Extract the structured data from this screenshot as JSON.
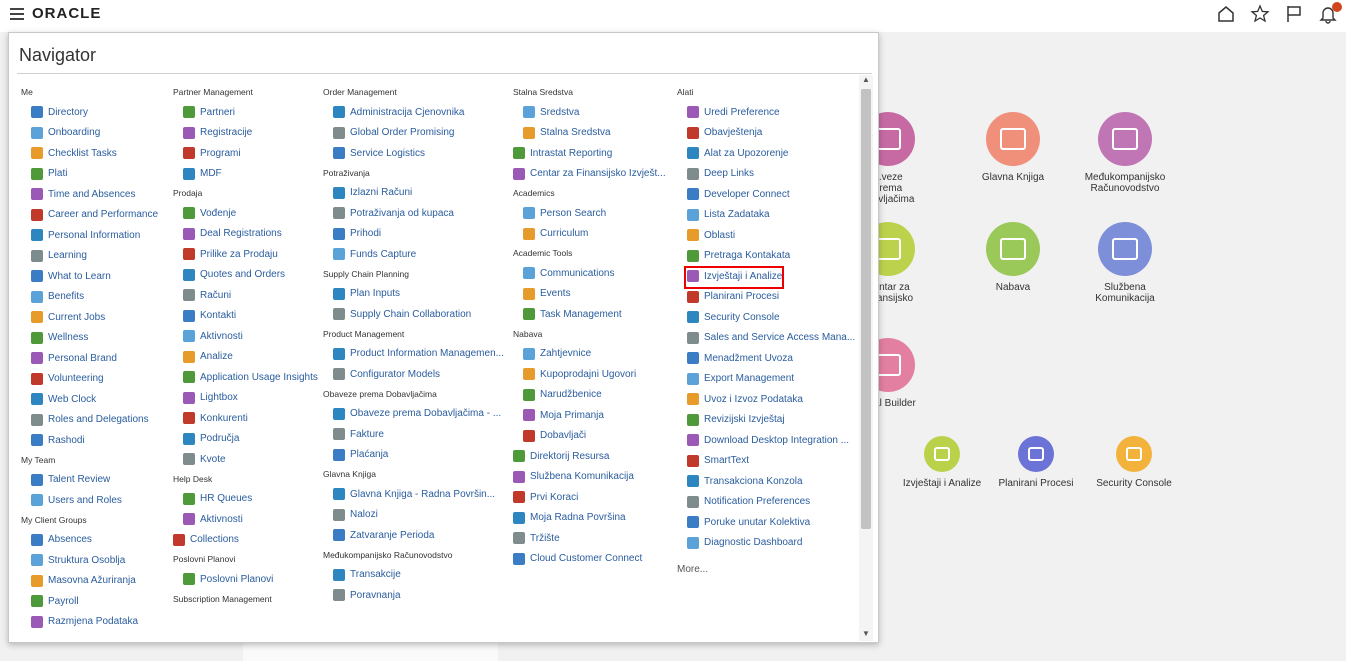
{
  "header": {
    "logo": "ORACLE",
    "icons": [
      "menu-icon",
      "home-icon",
      "star-icon",
      "flag-icon",
      "bell-icon"
    ]
  },
  "navigator": {
    "title": "Navigator",
    "columns": [
      {
        "groups": [
          {
            "title": "Me",
            "items": [
              "Directory",
              "Onboarding",
              "Checklist Tasks",
              "Plati",
              "Time and Absences",
              "Career and Performance",
              "Personal Information",
              "Learning",
              "What to Learn",
              "Benefits",
              "Current Jobs",
              "Wellness",
              "Personal Brand",
              "Volunteering",
              "Web Clock",
              "Roles and Delegations",
              "Rashodi"
            ]
          },
          {
            "title": "My Team",
            "items": [
              "Talent Review",
              "Users and Roles"
            ]
          },
          {
            "title": "My Client Groups",
            "items": [
              "Absences",
              "Struktura Osoblja",
              "Masovna Ažuriranja",
              "Payroll",
              "Razmjena Podataka"
            ]
          }
        ]
      },
      {
        "groups": [
          {
            "title": "Partner Management",
            "items": [
              "Partneri",
              "Registracije",
              "Programi",
              "MDF"
            ]
          },
          {
            "title": "Prodaja",
            "items": [
              "Vođenje",
              "Deal Registrations",
              "Prilike za Prodaju",
              "Quotes and Orders",
              "Računi",
              "Kontakti",
              "Aktivnosti",
              "Analize",
              "Application Usage Insights",
              "Lightbox",
              "Konkurenti",
              "Područja",
              "Kvote"
            ]
          },
          {
            "title": "Help Desk",
            "items": [
              "HR Queues",
              "Aktivnosti"
            ],
            "plain_items": [
              "Collections"
            ]
          },
          {
            "title": "Poslovni Planovi",
            "items": [
              "Poslovni Planovi"
            ]
          },
          {
            "title": "Subscription Management",
            "items": []
          }
        ]
      },
      {
        "groups": [
          {
            "title": "Order Management",
            "items": [
              "Administracija Cjenovnika",
              "Global Order Promising",
              "Service Logistics"
            ]
          },
          {
            "title": "Potraživanja",
            "items": [
              "Izlazni Računi",
              "Potraživanja od kupaca",
              "Prihodi",
              "Funds Capture"
            ]
          },
          {
            "title": "Supply Chain Planning",
            "items": [
              "Plan Inputs",
              "Supply Chain Collaboration"
            ]
          },
          {
            "title": "Product Management",
            "items": [
              "Product Information Managemen...",
              "Configurator Models"
            ]
          },
          {
            "title": "Obaveze prema Dobavljačima",
            "items": [
              "Obaveze prema Dobavljačima - ...",
              "Fakture",
              "Plaćanja"
            ]
          },
          {
            "title": "Glavna Knjiga",
            "items": [
              "Glavna Knjiga - Radna Površin...",
              "Nalozi",
              "Zatvaranje Perioda"
            ]
          },
          {
            "title": "Međukompanijsko Računovodstvo",
            "items": [
              "Transakcije",
              "Poravnanja"
            ]
          }
        ]
      },
      {
        "groups": [
          {
            "title": "Stalna Sredstva",
            "items": [
              "Sredstva",
              "Stalna Sredstva"
            ]
          },
          {
            "title": "",
            "plain_items": [
              "Intrastat Reporting",
              "Centar za Finansijsko Izvješt..."
            ]
          },
          {
            "title": "Academics",
            "items": [
              "Person Search",
              "Curriculum"
            ]
          },
          {
            "title": "Academic Tools",
            "items": [
              "Communications",
              "Events",
              "Task Management"
            ]
          },
          {
            "title": "Nabava",
            "items": [
              "Zahtjevnice",
              "Kupoprodajni Ugovori",
              "Narudžbenice",
              "Moja Primanja",
              "Dobavljači"
            ]
          },
          {
            "title": "",
            "plain_items": [
              "Direktorij Resursa",
              "Službena Komunikacija",
              "Prvi Koraci",
              "Moja Radna Površina",
              "Tržište",
              "Cloud Customer Connect"
            ]
          }
        ]
      },
      {
        "groups": [
          {
            "title": "Alati",
            "items": [
              "Uredi Preference",
              "Obavještenja",
              "Alat za Upozorenje",
              "Deep Links",
              "Developer Connect",
              "Lista Zadataka",
              "Oblasti",
              "Pretraga Kontakata",
              "Izvještaji i Analize",
              "Planirani Procesi",
              "Security Console",
              "Sales and Service Access Mana...",
              "Menadžment Uvoza",
              "Export Management",
              "Uvoz i Izvoz Podataka",
              "Revizijski Izvještaj",
              "Download Desktop Integration ...",
              "SmartText",
              "Transakciona Konzola",
              "Notification Preferences",
              "Poruke unutar Kolektiva",
              "Diagnostic Dashboard"
            ]
          }
        ],
        "more": "More..."
      }
    ],
    "highlighted_item": "Izvještaji i Analize"
  },
  "background_tiles": [
    {
      "label": "...veze prema\nobavljačima",
      "color": "#c76aa3"
    },
    {
      "label": "Glavna Knjiga",
      "color": "#f0907b"
    },
    {
      "label": "Međukompanijsko\nRačunovodstvo",
      "color": "#c076b4"
    },
    {
      "label": "Centar za\n...nansijsko",
      "color": "#bcd24d"
    },
    {
      "label": "Nabava",
      "color": "#9ac95a"
    },
    {
      "label": "Službena\nKomunikacija",
      "color": "#7d8fd8"
    },
    {
      "label": "...ual Builder",
      "color": "#e37fa0"
    },
    {
      "label": "Izvještaji i Analize",
      "color": "#b9d24a"
    },
    {
      "label": "Planirani Procesi",
      "color": "#6b73d6"
    },
    {
      "label": "Security Console",
      "color": "#f2b23c"
    }
  ]
}
